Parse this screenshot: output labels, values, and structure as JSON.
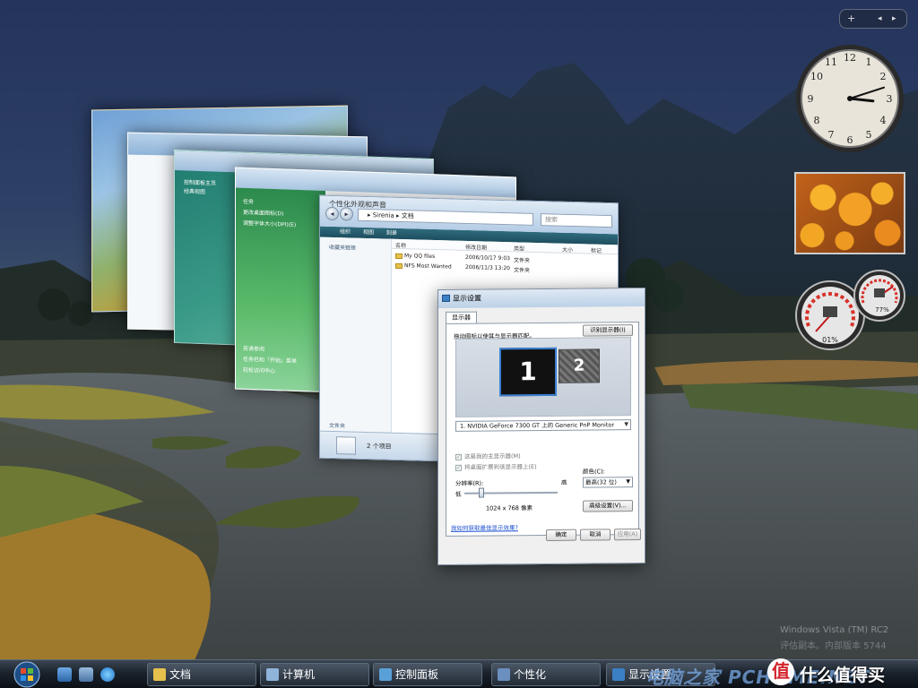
{
  "explorer": {
    "window_title": "个性化外观和声音",
    "breadcrumb": "▸ Sirenia ▸ 文档",
    "search_placeholder": "搜索",
    "toolbar": [
      "组织",
      "视图",
      "刻录"
    ],
    "favorites_label": "收藏夹链接",
    "folders_label": "文件夹",
    "columns": [
      "名称",
      "修改日期",
      "类型",
      "大小",
      "标记"
    ],
    "rows": [
      {
        "name": "My QQ files",
        "date": "2006/10/17 9:03",
        "type": "文件夹"
      },
      {
        "name": "NFS Most Wanted",
        "date": "2006/11/3 13:20",
        "type": "文件夹"
      }
    ],
    "status_count": "2 个项目"
  },
  "control_window": {
    "sidebar_items": [
      "任务",
      "更改桌面图标(D)",
      "调整字体大小(DPI)(E)"
    ],
    "sidebar_bottom": [
      "另请参阅",
      "任务栏和「开始」菜单",
      "轻松访问中心"
    ]
  },
  "control_panel_window": {
    "sidebar_items": [
      "控制面板主页",
      "经典视图"
    ]
  },
  "display_dialog": {
    "title": "显示设置",
    "tab": "显示器",
    "instruction": "拖动图标以使其与显示器匹配。",
    "identify_button": "识别显示器(I)",
    "monitor1": "1",
    "monitor2": "2",
    "monitor_select": "1. NVIDIA GeForce 7300 GT 上的 Generic PnP Monitor",
    "checkbox1": "这是我的主显示器(M)",
    "checkbox2": "将桌面扩展到该显示器上(E)",
    "resolution_label": "分辨率(R):",
    "low_label": "低",
    "high_label": "高",
    "resolution_value": "1024 x 768 像素",
    "colors_label": "颜色(C):",
    "colors_value": "最高(32 位)",
    "advanced_button": "高级设置(V)...",
    "help_link": "我如何获取最佳显示效果?",
    "ok_button": "确定",
    "cancel_button": "取消",
    "apply_button": "应用(A)"
  },
  "gadgets": {
    "bar_add": "+",
    "bar_prev": "◂",
    "bar_next": "▸",
    "cpu_percent": "01%",
    "memory_percent": "77%",
    "clock_hour": 3,
    "clock_minute": 12
  },
  "watermark": {
    "line1": "Windows Vista (TM) RC2",
    "line2": "评估副本。内部版本 5744"
  },
  "taskbar": {
    "tasks": [
      "文档",
      "计算机",
      "控制面板",
      "个性化",
      "显示设置"
    ],
    "brand": "电脑之家 PCHOME.NET",
    "site_logo": "值",
    "site_name": "什么值得买"
  },
  "colors": {
    "accent": "#3a7fd0",
    "taskbar": "#1a222b",
    "link": "#1a4fd1"
  }
}
